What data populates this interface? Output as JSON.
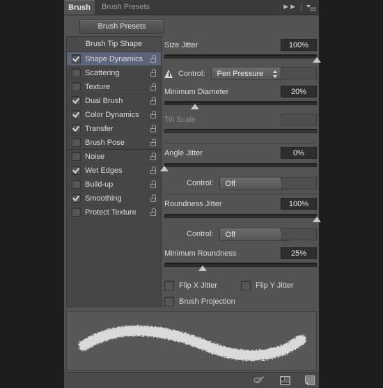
{
  "window": {
    "tabs": [
      {
        "label": "Brush",
        "active": true
      },
      {
        "label": "Brush Presets",
        "active": false
      }
    ],
    "collapse_icon": "double-chevron-right-icon",
    "menu_icon": "panel-menu-icon"
  },
  "presets_button": {
    "label": "Brush Presets"
  },
  "options_list": {
    "header": "Brush Tip Shape",
    "items": [
      {
        "label": "Shape Dynamics",
        "checked": true,
        "selected": true,
        "lock": "unlocked-icon",
        "group_end": false
      },
      {
        "label": "Scattering",
        "checked": false,
        "selected": false,
        "lock": "unlocked-icon",
        "group_end": false
      },
      {
        "label": "Texture",
        "checked": false,
        "selected": false,
        "lock": "unlocked-icon",
        "group_end": false
      },
      {
        "label": "Dual Brush",
        "checked": true,
        "selected": false,
        "lock": "unlocked-icon",
        "group_end": false
      },
      {
        "label": "Color Dynamics",
        "checked": true,
        "selected": false,
        "lock": "unlocked-icon",
        "group_end": false
      },
      {
        "label": "Transfer",
        "checked": true,
        "selected": false,
        "lock": "unlocked-icon",
        "group_end": false
      },
      {
        "label": "Brush Pose",
        "checked": false,
        "selected": false,
        "lock": "unlocked-icon",
        "group_end": true
      },
      {
        "label": "Noise",
        "checked": false,
        "selected": false,
        "lock": "unlocked-icon",
        "group_end": false
      },
      {
        "label": "Wet Edges",
        "checked": true,
        "selected": false,
        "lock": "unlocked-icon",
        "group_end": false
      },
      {
        "label": "Build-up",
        "checked": false,
        "selected": false,
        "lock": "unlocked-icon",
        "group_end": false
      },
      {
        "label": "Smoothing",
        "checked": true,
        "selected": false,
        "lock": "unlocked-icon",
        "group_end": false
      },
      {
        "label": "Protect Texture",
        "checked": false,
        "selected": false,
        "lock": "unlocked-icon",
        "group_end": false
      }
    ]
  },
  "size_section": {
    "jitter_label": "Size Jitter",
    "jitter_value": "100%",
    "jitter_slider_pct": 100,
    "warning_icon": "warning-triangle-icon",
    "control_label": "Control:",
    "control_value": "Pen Pressure",
    "min_diameter_label": "Minimum Diameter",
    "min_diameter_value": "20%",
    "min_diameter_slider_pct": 20,
    "tilt_scale_label": "Tilt Scale",
    "tilt_scale_value": "",
    "tilt_scale_slider_pct": 0
  },
  "angle_section": {
    "jitter_label": "Angle Jitter",
    "jitter_value": "0%",
    "jitter_slider_pct": 0,
    "control_label": "Control:",
    "control_value": "Off"
  },
  "roundness_section": {
    "jitter_label": "Roundness Jitter",
    "jitter_value": "100%",
    "jitter_slider_pct": 100,
    "control_label": "Control:",
    "control_value": "Off",
    "min_roundness_label": "Minimum Roundness",
    "min_roundness_value": "25%",
    "min_roundness_slider_pct": 25
  },
  "flip_options": [
    {
      "label": "Flip X Jitter",
      "checked": false
    },
    {
      "label": "Flip Y Jitter",
      "checked": false
    },
    {
      "label": "Brush Projection",
      "checked": false
    }
  ],
  "footer": {
    "icons": [
      {
        "name": "toggle-brush-preview-icon"
      },
      {
        "name": "brush-presets-grid-icon"
      },
      {
        "name": "new-brush-preset-icon"
      }
    ]
  },
  "colors": {
    "panel_bg": "#535353",
    "tabbar_bg": "#3a3a3a",
    "selection_blue": "#5b6478",
    "value_field_bg": "#2e2e2e",
    "text": "#dcdcdc",
    "disabled_text": "#8d8d8d"
  }
}
